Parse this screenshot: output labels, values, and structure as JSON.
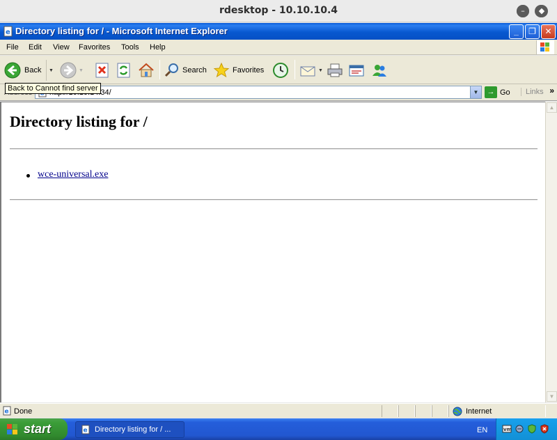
{
  "host": {
    "title": "rdesktop - 10.10.10.4"
  },
  "window": {
    "title": "Directory listing for / - Microsoft Internet Explorer"
  },
  "menu": [
    "File",
    "Edit",
    "View",
    "Favorites",
    "Tools",
    "Help"
  ],
  "toolbar": {
    "back_label": "Back",
    "search_label": "Search",
    "favorites_label": "Favorites"
  },
  "tooltip": "Back to Cannot find server",
  "address": {
    "label": "Address",
    "url": "http://10.10.14.34/",
    "go_label": "Go",
    "links_label": "Links"
  },
  "page": {
    "heading": "Directory listing for /",
    "files": [
      "wce-universal.exe"
    ]
  },
  "status": {
    "text": "Done",
    "zone": "Internet"
  },
  "taskbar": {
    "start_label": "start",
    "task_label": "Directory listing for / ...",
    "lang": "EN"
  },
  "colors": {
    "title_blue": "#0a5bd8",
    "start_green": "#3b9d38",
    "link": "#00008b"
  }
}
